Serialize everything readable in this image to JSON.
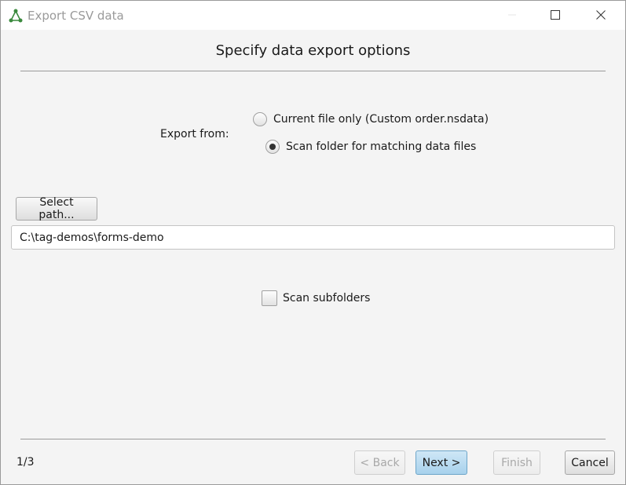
{
  "window": {
    "title": "Export CSV data"
  },
  "heading": "Specify data export options",
  "export_from": {
    "label": "Export from:",
    "options": [
      {
        "label": "Current file only (Custom order.nsdata)",
        "selected": false
      },
      {
        "label": "Scan folder for matching data files",
        "selected": true
      }
    ]
  },
  "path": {
    "button_label": "Select path...",
    "value": "C:\\tag-demos\\forms-demo"
  },
  "scan_subfolders": {
    "label": "Scan subfolders",
    "checked": false
  },
  "footer": {
    "page_indicator": "1/3",
    "back_label": "< Back",
    "next_label": "Next >",
    "finish_label": "Finish",
    "cancel_label": "Cancel"
  },
  "colors": {
    "accent": "#a7d1ec",
    "app_icon": "#3b8a3e"
  }
}
